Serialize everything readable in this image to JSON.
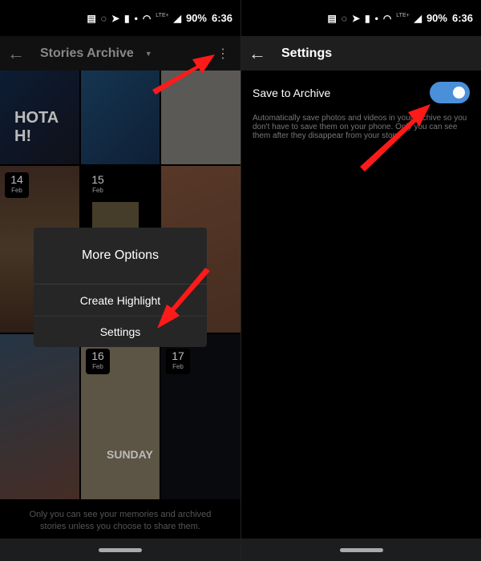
{
  "status_bar": {
    "battery": "90%",
    "time": "6:36",
    "network": "LTE+",
    "icons": [
      "message-icon",
      "whatsapp-icon",
      "telegram-icon",
      "battery-icon",
      "dot-icon",
      "lte-call-icon",
      "wifi-icon",
      "signal-icon"
    ]
  },
  "archive": {
    "title": "Stories Archive",
    "tiles": [
      {
        "day": "14",
        "month": "Feb"
      },
      {
        "day": "15",
        "month": "Feb"
      },
      {
        "day": "16",
        "month": "Feb"
      },
      {
        "day": "17",
        "month": "Feb"
      }
    ],
    "tile_captions": [
      "HOTA H!",
      "SUNDAY"
    ],
    "menu": {
      "title": "More Options",
      "items": [
        "Create Highlight",
        "Settings"
      ]
    },
    "footer": "Only you can see your memories and archived stories unless you choose to share them."
  },
  "settings": {
    "title": "Settings",
    "save_to_archive": {
      "label": "Save to Archive",
      "enabled": true,
      "description": "Automatically save photos and videos in your archive so you don't have to save them on your phone. Only you can see them after they disappear from your story."
    }
  },
  "colors": {
    "accent": "#4a90d9",
    "arrow": "#ff1a1a",
    "popup": "#262626",
    "toolbar": "#1e1e1e"
  }
}
